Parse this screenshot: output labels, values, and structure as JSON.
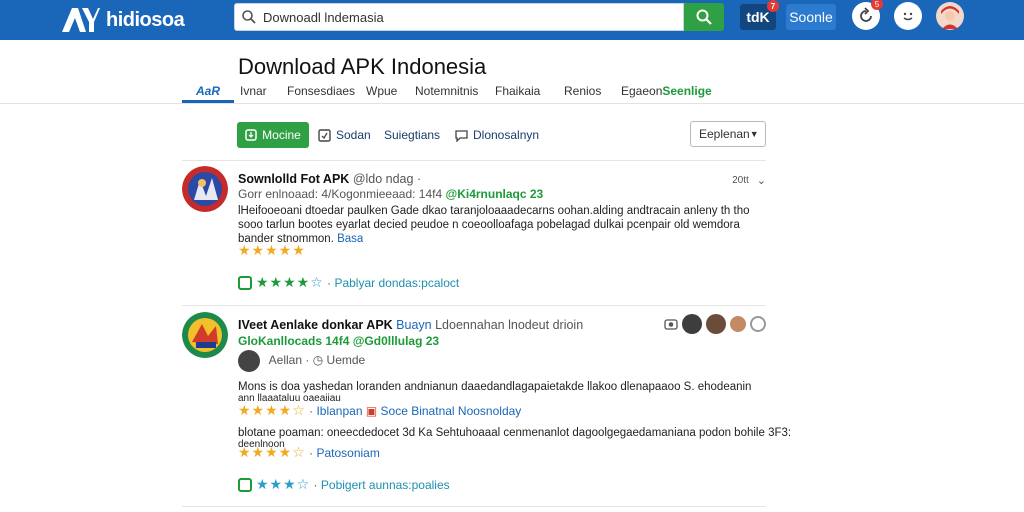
{
  "header": {
    "logo_text": "hidiosoa",
    "search": {
      "value": "Downoadl lndemasia",
      "placeholder": ""
    },
    "action_1": "tdK",
    "action_1_badge": "7",
    "action_2": "Soonle",
    "circle_badge": "5"
  },
  "page": {
    "title": "Download APK Indonesia",
    "tabs": [
      {
        "label": "AaR",
        "active": true
      },
      {
        "label": "Ivnar"
      },
      {
        "label": "Fonsesdiaes"
      },
      {
        "label": "Wpue"
      },
      {
        "label": "Notemnitnis"
      },
      {
        "label": "Fhaikaia"
      },
      {
        "label": "Renios"
      },
      {
        "label": "Egaeon",
        "highlight": "Seenlige"
      }
    ]
  },
  "filters": {
    "primary": "Mocine",
    "chip_2": "Sodan",
    "chip_3": "Suiegtians",
    "chip_4": "Dlonosalnyn",
    "sort": "Eeplenan"
  },
  "listings": [
    {
      "title": "Sownlolld Fot APK",
      "meta": "@ldo ndag",
      "date": "20tt",
      "sub_grey": "Gorr enlnoaad: 4/Kogonmieeaad: 14f4",
      "sub_green": "@Ki4rnunlaqc 23",
      "desc_1": "lHeifooeoani dtoedar paulken Gade dkao taranjoloaaadecarns oohan.alding andtracain anleny th tho",
      "desc_2": "sooo tarlun bootes eyarlat decied peudoe n coeoolloafaga pobelagad dulkai pcenpair old wemdora",
      "desc_3": "bander stnommon.",
      "desc_link": "Basa",
      "link": "Pablyar dondas:pcaloct"
    },
    {
      "title": "IVeet Aenlake donkar APK",
      "meta": "Buayn",
      "meta_2": "Ldoennahan lnodeut drioin",
      "sub_green": "GloKanllocads 14f4 @Gd0lllulag 23",
      "author": "Aellan",
      "author_meta": "Uemde",
      "desc_1": "Mons is doa yashedan loranden andnianun daaedandlagapaietakde llakoo dlenapaaoo S. ehodeanin",
      "desc_2": "ann llaaataluu oaeaiiau",
      "rating_link_1": "Iblanpan",
      "rating_link_2": "Soce Binatnal Noosnolday",
      "desc_3": "blotane poaman: oneecdedocet 3d Ka Sehtuhoaaal cenmenanlot dagoolgegaedamaniana podon bohile 3F3:",
      "desc_4": "deenlnoon",
      "rating_link_3": "Patosoniam",
      "link": "Pobigert aunnas:poalies"
    }
  ]
}
